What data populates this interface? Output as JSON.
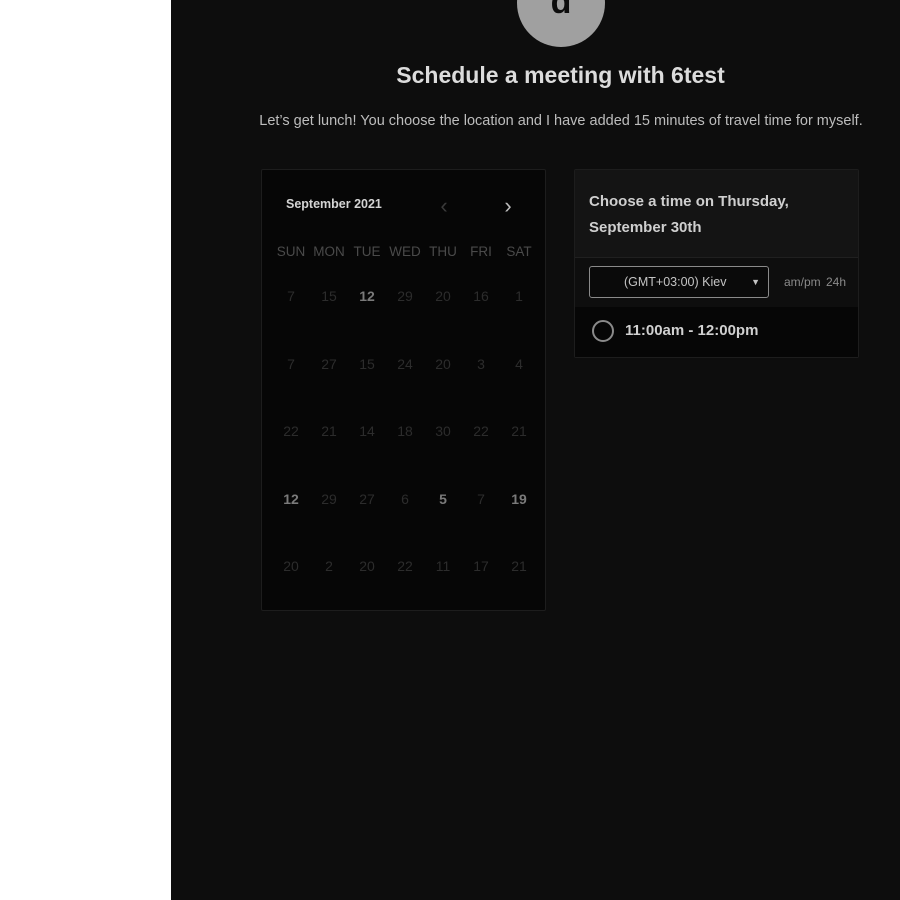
{
  "avatar": {
    "initial": "d"
  },
  "header": {
    "title": "Schedule a meeting with 6test",
    "subtitle": "Let’s get lunch! You choose the location and I have added 15 minutes of travel time for myself."
  },
  "calendar": {
    "month_label": "September 2021",
    "prev_icon": "‹",
    "next_icon": "›",
    "weekdays": [
      "SUN",
      "MON",
      "TUE",
      "WED",
      "THU",
      "FRI",
      "SAT"
    ],
    "weeks": [
      [
        "7",
        "15",
        "12",
        "29",
        "20",
        "16",
        "1"
      ],
      [
        "7",
        "27",
        "15",
        "24",
        "20",
        "3",
        "4"
      ],
      [
        "22",
        "21",
        "14",
        "18",
        "30",
        "22",
        "21"
      ],
      [
        "12",
        "29",
        "27",
        "6",
        "5",
        "7",
        "19"
      ],
      [
        "20",
        "2",
        "20",
        "22",
        "11",
        "17",
        "21"
      ]
    ]
  },
  "times": {
    "title": "Choose a time on Thursday, September 30th",
    "timezone": "(GMT+03:00) Kiev",
    "format_ampm": "am/pm",
    "format_24h": "24h",
    "slots": [
      "11:00am - 12:00pm"
    ]
  }
}
